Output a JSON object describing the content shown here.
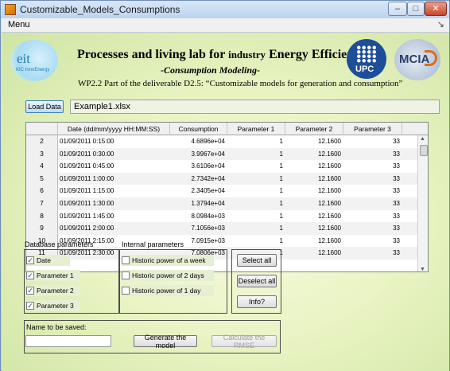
{
  "window": {
    "title": "Customizable_Models_Consumptions"
  },
  "menubar": {
    "menu": "Menu"
  },
  "header": {
    "eit_mark": "eit",
    "eit_sub": "KIC InnoEnergy",
    "title_a": "Processes and living lab for ",
    "title_small": "industry",
    "title_b": "  Energy Efficiency",
    "subtitle": "-Consumption Modeling-",
    "wp_line": "WP2.2 Part of the deliverable D2.5: “Customizable models for generation and consumption”",
    "upc_text": "UPC",
    "mcia_text": "MCIA"
  },
  "load": {
    "button": "Load Data",
    "filename": "Example1.xlsx"
  },
  "table": {
    "columns": [
      "Date (dd/mm/yyyy HH:MM:SS)",
      "Consumption",
      "Parameter 1",
      "Parameter 2",
      "Parameter 3"
    ],
    "rows": [
      {
        "idx": "2",
        "date": "01/09/2011 0:15:00",
        "cons": "4.6896e+04",
        "p1": "1",
        "p2": "12.1600",
        "p3": "33"
      },
      {
        "idx": "3",
        "date": "01/09/2011 0:30:00",
        "cons": "3.9967e+04",
        "p1": "1",
        "p2": "12.1600",
        "p3": "33"
      },
      {
        "idx": "4",
        "date": "01/09/2011 0:45:00",
        "cons": "3.6106e+04",
        "p1": "1",
        "p2": "12.1600",
        "p3": "33"
      },
      {
        "idx": "5",
        "date": "01/09/2011 1:00:00",
        "cons": "2.7342e+04",
        "p1": "1",
        "p2": "12.1600",
        "p3": "33"
      },
      {
        "idx": "6",
        "date": "01/09/2011 1:15:00",
        "cons": "2.3405e+04",
        "p1": "1",
        "p2": "12.1600",
        "p3": "33"
      },
      {
        "idx": "7",
        "date": "01/09/2011 1:30:00",
        "cons": "1.3794e+04",
        "p1": "1",
        "p2": "12.1600",
        "p3": "33"
      },
      {
        "idx": "8",
        "date": "01/09/2011 1:45:00",
        "cons": "8.0984e+03",
        "p1": "1",
        "p2": "12.1600",
        "p3": "33"
      },
      {
        "idx": "9",
        "date": "01/09/2011 2:00:00",
        "cons": "7.1056e+03",
        "p1": "1",
        "p2": "12.1600",
        "p3": "33"
      },
      {
        "idx": "10",
        "date": "01/09/2011 2:15:00",
        "cons": "7.0915e+03",
        "p1": "1",
        "p2": "12.1600",
        "p3": "33"
      },
      {
        "idx": "11",
        "date": "01/09/2011 2:30:00",
        "cons": "7.0806e+03",
        "p1": "1",
        "p2": "12.1600",
        "p3": "33"
      }
    ]
  },
  "db_params": {
    "label": "Database parameters",
    "items": [
      {
        "label": "Date",
        "checked": true
      },
      {
        "label": "Parameter 1",
        "checked": true
      },
      {
        "label": "Parameter 2",
        "checked": true
      },
      {
        "label": "Parameter 3",
        "checked": true
      }
    ]
  },
  "internal_params": {
    "label": "Internal parameters",
    "items": [
      {
        "label": "Historic power of a week",
        "checked": false
      },
      {
        "label": "Historic power of 2 days",
        "checked": false
      },
      {
        "label": "Historic power of 1 day",
        "checked": false
      }
    ]
  },
  "actions": {
    "select_all": "Select all",
    "deselect_all": "Deselect all",
    "info": "Info?"
  },
  "save": {
    "label": "Name to be saved:",
    "value": "",
    "generate": "Generate the model",
    "rmse": "Calculate the RMSE"
  },
  "check_mark": "✓"
}
